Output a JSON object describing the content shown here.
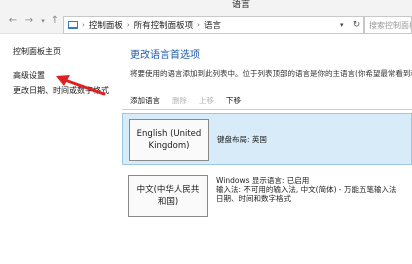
{
  "window": {
    "title": "语言"
  },
  "address_bar": {
    "crumbs": [
      "控制面板",
      "所有控制面板项",
      "语言"
    ],
    "search_placeholder": "搜索控制面板"
  },
  "left_pane": {
    "links": [
      "控制面板主页",
      "高级设置",
      "更改日期、时间或数字格式"
    ]
  },
  "main": {
    "title": "更改语言首选项",
    "description": "将要使用的语言添加到此列表中。位于列表顶部的语言是你的主语言(你希望最常看到和使用的",
    "toolbar": {
      "add": "添加语言",
      "remove": "删除",
      "up": "上移",
      "down": "下移"
    },
    "languages": [
      {
        "name_line1": "English (United",
        "name_line2": "Kingdom)",
        "info": [
          "键盘布局: 英国"
        ]
      },
      {
        "name_line1": "中文(中华人民共",
        "name_line2": "和国)",
        "info": [
          "Windows 显示语言: 已启用",
          "输入法: 不可用的输入法, 中文(简体) - 万能五笔输入法",
          "日期、时间和数字格式"
        ]
      }
    ]
  },
  "colors": {
    "accent_link": "#1e5aa8",
    "selected_row": "#d7ebf8",
    "arrow": "#e02020"
  }
}
